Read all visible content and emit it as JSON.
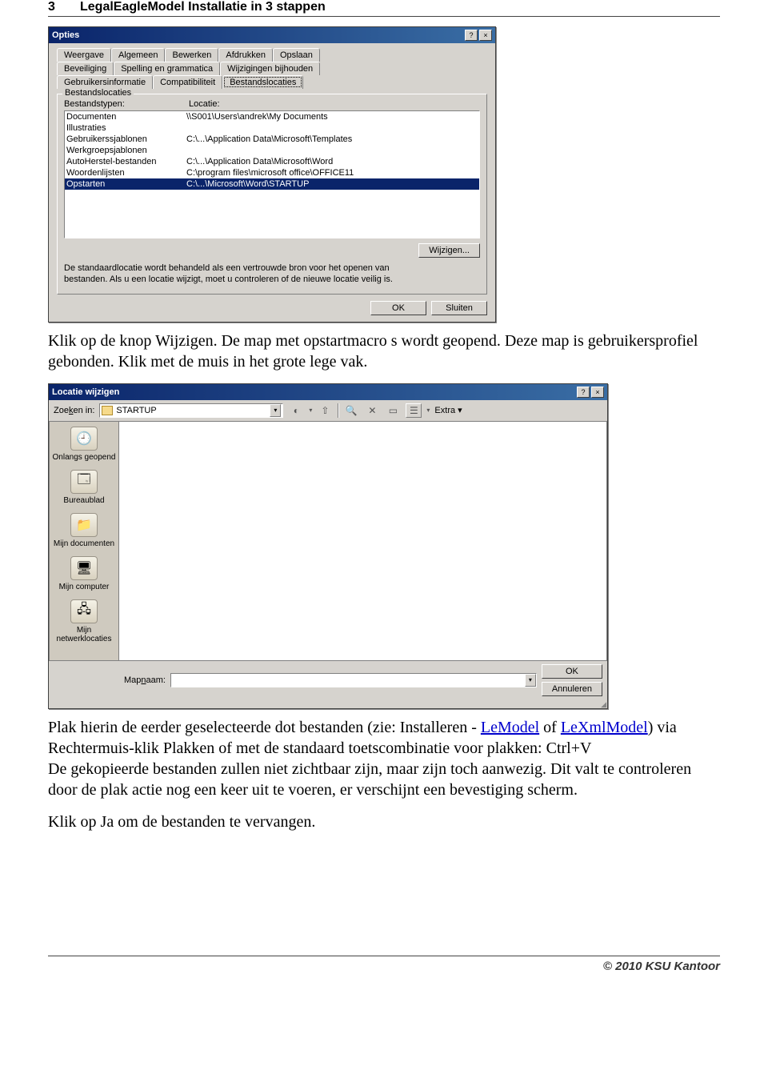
{
  "header": {
    "page_number": "3",
    "title": "LegalEagleModel Installatie in 3 stappen"
  },
  "footer": {
    "copyright": "© 2010 KSU Kantoor"
  },
  "dialog_options": {
    "title": "Opties",
    "help_btn": "?",
    "close_btn": "×",
    "tabs_row1": [
      "Weergave",
      "Algemeen",
      "Bewerken",
      "Afdrukken",
      "Opslaan"
    ],
    "tabs_row2": [
      "Beveiliging",
      "Spelling en grammatica",
      "Wijzigingen bijhouden"
    ],
    "tabs_row3": [
      "Gebruikersinformatie",
      "Compatibiliteit",
      "Bestandslocaties"
    ],
    "active_tab": "Bestandslocaties",
    "group_label": "Bestandslocaties",
    "col_types": "Bestandstypen:",
    "col_location": "Locatie:",
    "rows": [
      {
        "type": "Documenten",
        "loc": "\\\\S001\\Users\\andrek\\My Documents"
      },
      {
        "type": "Illustraties",
        "loc": ""
      },
      {
        "type": "Gebruikerssjablonen",
        "loc": "C:\\...\\Application Data\\Microsoft\\Templates"
      },
      {
        "type": "Werkgroepsjablonen",
        "loc": ""
      },
      {
        "type": "AutoHerstel-bestanden",
        "loc": "C:\\...\\Application Data\\Microsoft\\Word"
      },
      {
        "type": "Woordenlijsten",
        "loc": "C:\\program files\\microsoft office\\OFFICE11"
      },
      {
        "type": "Opstarten",
        "loc": "C:\\...\\Microsoft\\Word\\STARTUP"
      }
    ],
    "selected_index": 6,
    "wijzigen_btn": "Wijzigen...",
    "note": "De standaardlocatie wordt behandeld als een vertrouwde bron voor het openen van bestanden. Als u een locatie wijzigt, moet u controleren of de nieuwe locatie veilig is.",
    "ok_btn": "OK",
    "sluiten_btn": "Sluiten"
  },
  "para1": {
    "t1": "Klik op de knop Wijzigen. De map met opstartmacro s wordt geopend. Deze map is gebruikersprofiel gebonden. Klik met de muis in het grote lege vak."
  },
  "dialog_location": {
    "title": "Locatie wijzigen",
    "help_btn": "?",
    "close_btn": "×",
    "zoeken_label": "Zoeken in:",
    "zoeken_prefix": "Zoe",
    "zoeken_suffix": "en in:",
    "zoeken_underlined": "k",
    "folder": "STARTUP",
    "extra_label": "Extra",
    "places": [
      {
        "label": "Onlangs geopend",
        "glyph": "🕘"
      },
      {
        "label": "Bureaublad",
        "glyph": "🗔"
      },
      {
        "label": "Mijn documenten",
        "glyph": "📁"
      },
      {
        "label": "Mijn computer",
        "glyph": "🖥"
      },
      {
        "label": "Mijn netwerklocaties",
        "glyph": "🖧"
      }
    ],
    "mapnaam_prefix": "Map",
    "mapnaam_under": "n",
    "mapnaam_suffix": "aam:",
    "ok_btn": "OK",
    "annuleren_btn": "Annuleren"
  },
  "para2": {
    "pre": "Plak hierin de eerder geselecteerde dot bestanden (zie: Installeren - ",
    "link1": "LeModel",
    "mid1": " of ",
    "link2": "LeXmlModel",
    "post1": ") via Rechtermuis-klik Plakken of met de standaard toetscombinatie voor plakken: Ctrl+V",
    "line2": "De gekopieerde bestanden zullen niet zichtbaar zijn, maar zijn toch aanwezig. Dit valt te controleren door de plak actie nog een keer uit te voeren, er verschijnt een bevestiging scherm."
  },
  "para3": "Klik op Ja om de bestanden te vervangen."
}
